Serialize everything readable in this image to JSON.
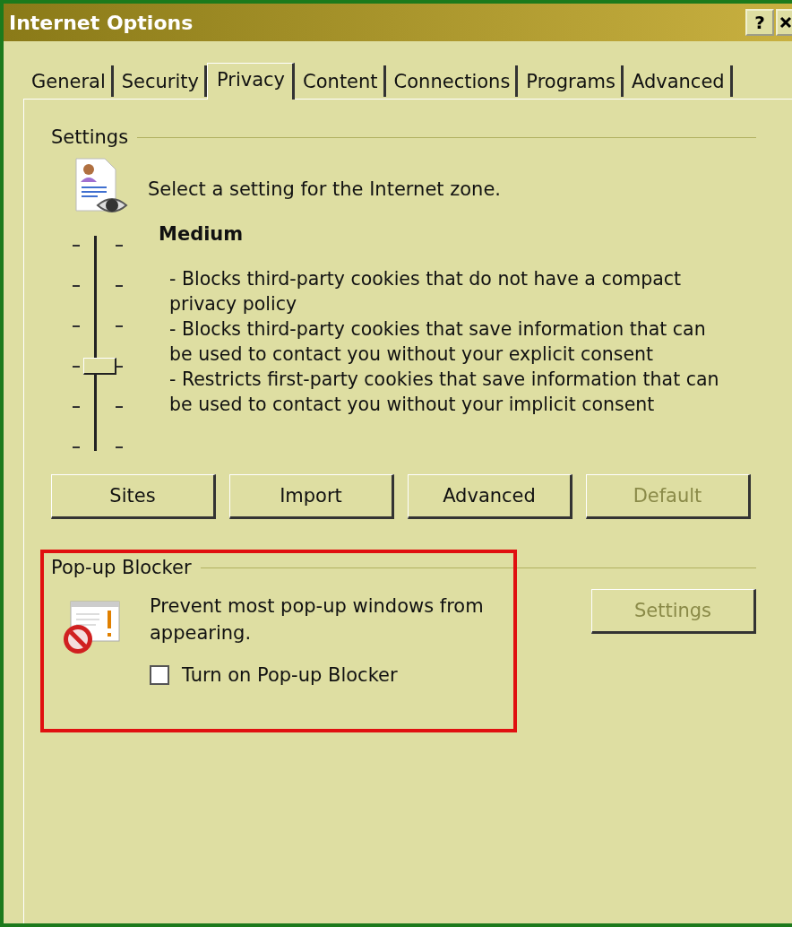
{
  "window": {
    "title": "Internet Options",
    "help": "?"
  },
  "tabs": [
    {
      "label": "General",
      "selected": false
    },
    {
      "label": "Security",
      "selected": false
    },
    {
      "label": "Privacy",
      "selected": true
    },
    {
      "label": "Content",
      "selected": false
    },
    {
      "label": "Connections",
      "selected": false
    },
    {
      "label": "Programs",
      "selected": false
    },
    {
      "label": "Advanced",
      "selected": false
    }
  ],
  "settings": {
    "label": "Settings",
    "prompt": "Select a setting for the Internet zone.",
    "slider": {
      "level": 0.4
    },
    "level_name": "Medium",
    "description": [
      "- Blocks third-party cookies that do not have a compact privacy policy",
      "- Blocks third-party cookies that save information that can be used to contact you without your explicit consent",
      "- Restricts first-party cookies that save information that can be used to contact you without your implicit consent"
    ],
    "buttons": [
      {
        "label": "Sites",
        "disabled": false
      },
      {
        "label": "Import",
        "disabled": false
      },
      {
        "label": "Advanced",
        "disabled": false
      },
      {
        "label": "Default",
        "disabled": true
      }
    ]
  },
  "popup_blocker": {
    "label": "Pop-up Blocker",
    "highlighted": true,
    "text": "Prevent most pop-up windows from appearing.",
    "checkbox": {
      "label": "Turn on Pop-up Blocker",
      "checked": false
    },
    "settings_button": {
      "label": "Settings",
      "disabled": true
    }
  }
}
